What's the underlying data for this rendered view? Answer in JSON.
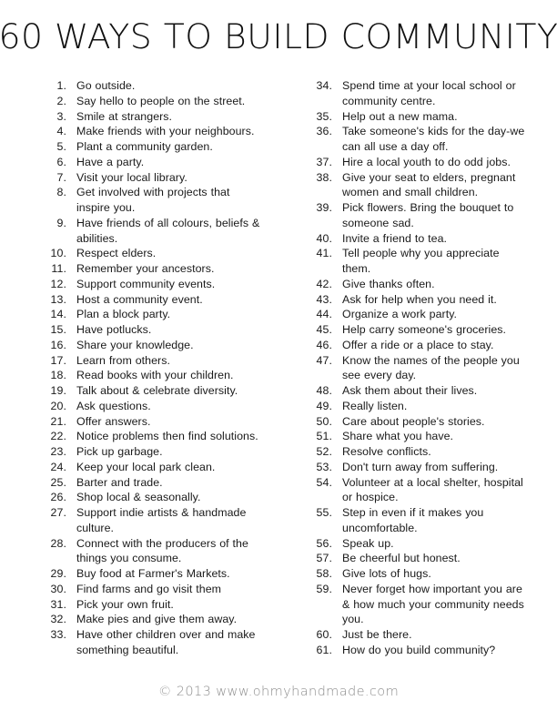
{
  "document": {
    "title": "60 WAYS TO BUILD COMMUNITY",
    "footer": "© 2013 www.ohmyhandmade.com",
    "text_color": "#1a1a1a",
    "footer_color": "#8d8d8d",
    "background_color": "#ffffff"
  },
  "columns": {
    "left": [
      {
        "num": "1.",
        "lines": [
          "Go outside."
        ]
      },
      {
        "num": "2.",
        "lines": [
          "Say hello to people on the street."
        ]
      },
      {
        "num": "3.",
        "lines": [
          "Smile at strangers."
        ]
      },
      {
        "num": "4.",
        "lines": [
          "Make friends with your neighbours."
        ]
      },
      {
        "num": "5.",
        "lines": [
          "Plant a community garden."
        ]
      },
      {
        "num": "6.",
        "lines": [
          "Have a party."
        ]
      },
      {
        "num": "7.",
        "lines": [
          "Visit your local library."
        ]
      },
      {
        "num": "8.",
        "lines": [
          "Get involved with projects that",
          "inspire you."
        ]
      },
      {
        "num": "9.",
        "lines": [
          "Have friends of all colours, beliefs &",
          "abilities."
        ]
      },
      {
        "num": "10.",
        "lines": [
          "Respect elders."
        ]
      },
      {
        "num": "11.",
        "lines": [
          "Remember your ancestors."
        ]
      },
      {
        "num": "12.",
        "lines": [
          "Support community events."
        ]
      },
      {
        "num": "13.",
        "lines": [
          "Host a community event."
        ]
      },
      {
        "num": "14.",
        "lines": [
          "Plan a block party."
        ]
      },
      {
        "num": "15.",
        "lines": [
          "Have potlucks."
        ]
      },
      {
        "num": "16.",
        "lines": [
          "Share your knowledge."
        ]
      },
      {
        "num": "17.",
        "lines": [
          "Learn from others."
        ]
      },
      {
        "num": "18.",
        "lines": [
          "Read books with your children."
        ]
      },
      {
        "num": "19.",
        "lines": [
          "Talk about & celebrate diversity."
        ]
      },
      {
        "num": "20.",
        "lines": [
          "Ask questions."
        ]
      },
      {
        "num": "21.",
        "lines": [
          "Offer answers."
        ]
      },
      {
        "num": "22.",
        "lines": [
          "Notice problems then find solutions."
        ]
      },
      {
        "num": "23.",
        "lines": [
          "Pick up garbage."
        ]
      },
      {
        "num": "24.",
        "lines": [
          "Keep your local park clean."
        ]
      },
      {
        "num": "25.",
        "lines": [
          "Barter and trade."
        ]
      },
      {
        "num": "26.",
        "lines": [
          "Shop local & seasonally."
        ]
      },
      {
        "num": "27.",
        "lines": [
          "Support indie artists & handmade",
          "culture."
        ]
      },
      {
        "num": "28.",
        "lines": [
          "Connect with the producers of the",
          "things you consume."
        ]
      },
      {
        "num": "29.",
        "lines": [
          "Buy food at Farmer's Markets."
        ]
      },
      {
        "num": "30.",
        "lines": [
          "Find farms and go visit them"
        ]
      },
      {
        "num": "31.",
        "lines": [
          "Pick your own fruit."
        ]
      },
      {
        "num": "32.",
        "lines": [
          "Make pies and give them away."
        ]
      },
      {
        "num": "33.",
        "lines": [
          "Have other children over and make",
          "something beautiful."
        ]
      }
    ],
    "right": [
      {
        "num": "34.",
        "lines": [
          "Spend time at your local school or",
          "community centre."
        ]
      },
      {
        "num": "35.",
        "lines": [
          "Help out a new mama."
        ]
      },
      {
        "num": "36.",
        "lines": [
          "Take someone's kids for the day-we",
          "can all use a day off."
        ]
      },
      {
        "num": "37.",
        "lines": [
          "Hire a local youth to do odd jobs."
        ]
      },
      {
        "num": "38.",
        "lines": [
          "Give your seat to elders, pregnant",
          "women and small children."
        ]
      },
      {
        "num": "39.",
        "lines": [
          "Pick flowers. Bring the bouquet to",
          "someone sad."
        ]
      },
      {
        "num": "40.",
        "lines": [
          "Invite a friend to tea."
        ]
      },
      {
        "num": "41.",
        "lines": [
          "Tell people why you appreciate",
          "them."
        ]
      },
      {
        "num": "42.",
        "lines": [
          "Give thanks often."
        ]
      },
      {
        "num": "43.",
        "lines": [
          "Ask for help when you need it."
        ]
      },
      {
        "num": "44.",
        "lines": [
          "Organize a work party."
        ]
      },
      {
        "num": "45.",
        "lines": [
          "Help carry someone's groceries."
        ]
      },
      {
        "num": "46.",
        "lines": [
          "Offer a ride or a place to stay."
        ]
      },
      {
        "num": "47.",
        "lines": [
          "Know the names of the people you",
          "see every day."
        ]
      },
      {
        "num": "48.",
        "lines": [
          "Ask them about their lives."
        ]
      },
      {
        "num": "49.",
        "lines": [
          "Really listen."
        ]
      },
      {
        "num": "50.",
        "lines": [
          "Care about people's stories."
        ]
      },
      {
        "num": "51.",
        "lines": [
          "Share what you have."
        ]
      },
      {
        "num": "52.",
        "lines": [
          "Resolve conflicts."
        ]
      },
      {
        "num": "53.",
        "lines": [
          "Don't turn away from suffering."
        ]
      },
      {
        "num": "54.",
        "lines": [
          "Volunteer at a local shelter, hospital",
          "or hospice."
        ]
      },
      {
        "num": "55.",
        "lines": [
          "Step in even if it makes you",
          "uncomfortable."
        ]
      },
      {
        "num": "56.",
        "lines": [
          "Speak up."
        ]
      },
      {
        "num": "57.",
        "lines": [
          "Be cheerful but honest."
        ]
      },
      {
        "num": "58.",
        "lines": [
          "Give lots of hugs."
        ]
      },
      {
        "num": "59.",
        "lines": [
          "Never forget how important you are",
          "& how much your community needs",
          "you."
        ]
      },
      {
        "num": "60.",
        "lines": [
          "Just be there."
        ]
      },
      {
        "num": "61.",
        "lines": [
          "How do you build community?"
        ]
      }
    ]
  }
}
